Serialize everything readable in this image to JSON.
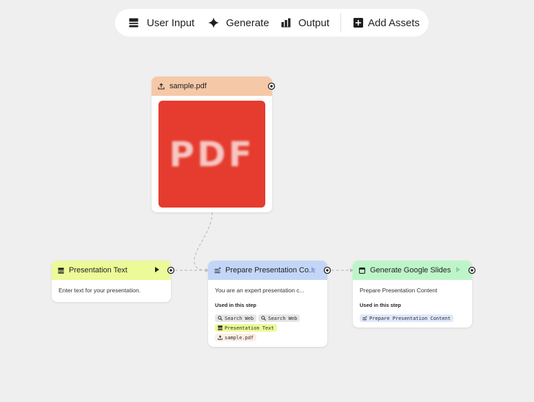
{
  "toolbar": {
    "items": [
      {
        "label": "User Input",
        "icon": "user-input-icon"
      },
      {
        "label": "Generate",
        "icon": "sparkle-icon"
      },
      {
        "label": "Output",
        "icon": "output-chart-icon"
      },
      {
        "label": "Add Assets",
        "icon": "add-box-icon"
      }
    ]
  },
  "nodes": {
    "pdf": {
      "title": "sample.pdf",
      "icon": "upload-icon",
      "header_color": "#f5c8a8",
      "thumbnail_text": "PDF",
      "thumbnail_color": "#e53c2f"
    },
    "text": {
      "title": "Presentation Text",
      "icon": "user-input-icon",
      "header_color": "#ecfa98",
      "body": "Enter text for your presentation."
    },
    "prepare": {
      "title": "Prepare Presentation Co...",
      "icon": "generate-text-icon",
      "header_color": "#c3d6f8",
      "body": "You are an expert presentation c...",
      "used_label": "Used in this step",
      "chips": [
        {
          "label": "Search Web",
          "icon": "search-icon",
          "color": "#e6e6e6"
        },
        {
          "label": "Search Web",
          "icon": "search-icon",
          "color": "#e6e6e6"
        },
        {
          "label": "Presentation Text",
          "icon": "user-input-icon",
          "color": "#ecfa98"
        },
        {
          "label": "sample.pdf",
          "icon": "upload-icon",
          "color": "#fdeee4"
        }
      ]
    },
    "slides": {
      "title": "Generate Google Slides",
      "icon": "slides-icon",
      "header_color": "#bdf5c9",
      "body": "Prepare Presentation Content",
      "used_label": "Used in this step",
      "chips": [
        {
          "label": "Prepare Presentation Content",
          "icon": "generate-text-icon",
          "color": "#dfe8fb"
        }
      ]
    }
  }
}
